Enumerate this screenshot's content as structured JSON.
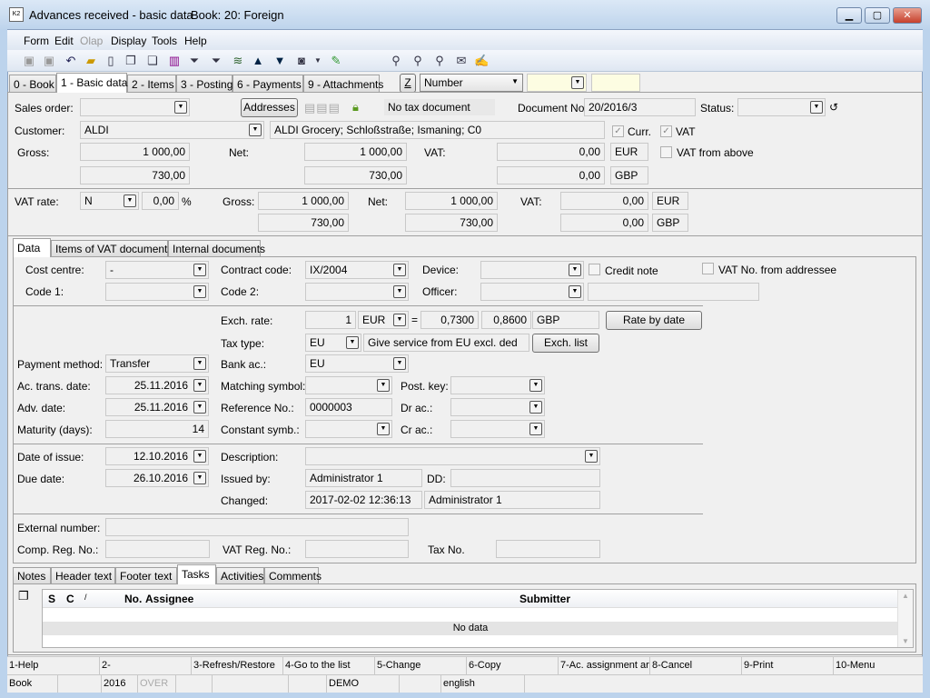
{
  "window": {
    "title": "Advances received - basic data",
    "book": "Book: 20: Foreign",
    "minimize": "▁",
    "maximize": "▢",
    "close": "✕"
  },
  "menu": [
    "Form",
    "Edit",
    "Olap",
    "Display",
    "Tools",
    "Help"
  ],
  "tabs": [
    "0 - Book",
    "1 - Basic data",
    "2 - Items",
    "3 - Posting",
    "6 - Payments",
    "9 - Attachments"
  ],
  "sort": {
    "z_button": "Z",
    "select": "Number"
  },
  "header": {
    "sales_order_label": "Sales order:",
    "sales_order": "",
    "addresses_button": "Addresses",
    "tax_doc": "No tax document",
    "document_no_label": "Document No.:",
    "document_no": "20/2016/3",
    "status_label": "Status:",
    "status": "",
    "customer_label": "Customer:",
    "customer": "ALDI",
    "customer_address": "ALDI Grocery; Schloßstraße; Ismaning; C0",
    "curr_label": "Curr.",
    "curr_checked": true,
    "vat_label": "VAT",
    "vat_checked": true,
    "gross_label": "Gross:",
    "gross": "1 000,00",
    "gross2": "730,00",
    "net_label": "Net:",
    "net": "1 000,00",
    "net2": "730,00",
    "vat_amount_label": "VAT:",
    "vat": "0,00",
    "vat2": "0,00",
    "cur1": "EUR",
    "cur2": "GBP",
    "vat_from_above_label": "VAT from above",
    "vat_from_above": false,
    "vat_rate_label": "VAT rate:",
    "vat_rate": "N",
    "vat_pct": "0,00",
    "pct": "%",
    "r_gross_label": "Gross:",
    "r_gross": "1 000,00",
    "r_gross2": "730,00",
    "r_net_label": "Net:",
    "r_net": "1 000,00",
    "r_net2": "730,00",
    "r_vat_label": "VAT:",
    "r_vat": "0,00",
    "r_vat2": "0,00",
    "r_cur1": "EUR",
    "r_cur2": "GBP"
  },
  "subtabs": [
    "Data",
    "Items of VAT documents",
    "Internal documents"
  ],
  "data": {
    "cost_centre_label": "Cost centre:",
    "cost_centre": "-",
    "contract_code_label": "Contract code:",
    "contract_code": "IX/2004",
    "device_label": "Device:",
    "device": "",
    "credit_note_label": "Credit note",
    "vat_no_addressee_label": "VAT No. from addressee",
    "code1_label": "Code 1:",
    "code1": "",
    "code2_label": "Code 2:",
    "code2": "",
    "officer_label": "Officer:",
    "officer": "",
    "officer_name": "",
    "exch_rate_label": "Exch. rate:",
    "exch_qty": "1",
    "exch_cur": "EUR",
    "eq": "=",
    "rate1": "0,7300",
    "rate2": "0,8600",
    "exch_target": "GBP",
    "rate_by_date": "Rate by date",
    "tax_type_label": "Tax type:",
    "tax_type": "EU",
    "tax_type_desc": "Give service from EU excl. ded",
    "exch_list": "Exch. list",
    "payment_method_label": "Payment method:",
    "payment_method": "Transfer",
    "bank_ac_label": "Bank ac.:",
    "bank_ac": "EU",
    "ac_trans_date_label": "Ac. trans. date:",
    "ac_trans_date": "25.11.2016",
    "matching_symbol_label": "Matching symbol:",
    "post_key_label": "Post. key:",
    "adv_date_label": "Adv. date:",
    "adv_date": "25.11.2016",
    "reference_no_label": "Reference No.:",
    "reference_no": "0000003",
    "dr_ac_label": "Dr ac.:",
    "maturity_label": "Maturity (days):",
    "maturity": "14",
    "constant_symb_label": "Constant symb.:",
    "cr_ac_label": "Cr ac.:",
    "date_of_issue_label": "Date of issue:",
    "date_of_issue": "12.10.2016",
    "description_label": "Description:",
    "description": "",
    "due_date_label": "Due date:",
    "due_date": "26.10.2016",
    "issued_by_label": "Issued by:",
    "issued_by": "Administrator 1",
    "dd_label": "DD:",
    "dd": "",
    "changed_label": "Changed:",
    "changed": "2017-02-02 12:36:13",
    "changed_by": "Administrator 1",
    "external_number_label": "External number:",
    "comp_reg_label": "Comp. Reg. No.:",
    "vat_reg_label": "VAT Reg. No.:",
    "tax_no_label": "Tax No."
  },
  "bottom_tabs": [
    "Notes",
    "Header text",
    "Footer text",
    "Tasks",
    "Activities",
    "Comments"
  ],
  "grid": {
    "columns": [
      "S",
      "C",
      "/",
      "No.",
      "Assignee",
      "Submitter"
    ],
    "empty": "No data"
  },
  "function_keys": [
    "1-Help",
    "2-",
    "3-Refresh/Restore",
    "4-Go to the list",
    "5-Change",
    "6-Copy",
    "7-Ac. assignment ar",
    "8-Cancel",
    "9-Print",
    "10-Menu"
  ],
  "status_bar": {
    "book": "Book",
    "year": "2016",
    "over": "OVER",
    "db": "DEMO",
    "lang": "english"
  }
}
